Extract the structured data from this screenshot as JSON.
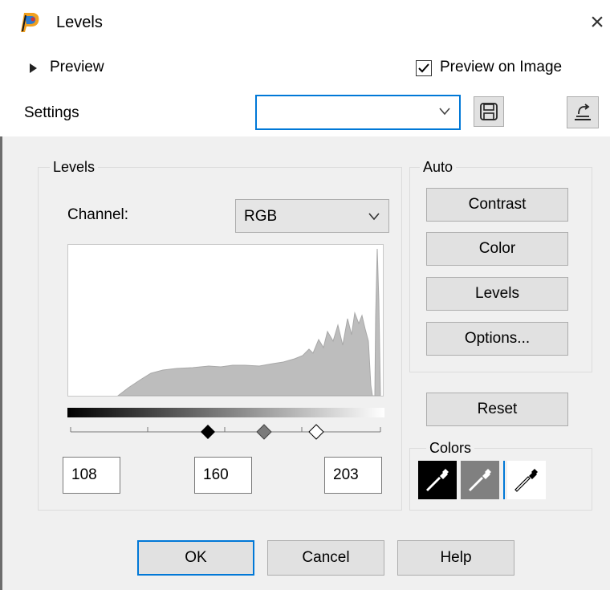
{
  "window": {
    "title": "Levels",
    "close_glyph": "×"
  },
  "top": {
    "preview_toggle": "Preview",
    "preview_on_image": {
      "label": "Preview on Image",
      "checked": true
    },
    "settings_label": "Settings",
    "settings_value": ""
  },
  "levels_group": {
    "label": "Levels",
    "channel_label": "Channel:",
    "channel_value": "RGB",
    "inputs": {
      "black": "108",
      "gray": "160",
      "white": "203"
    }
  },
  "auto_group": {
    "label": "Auto",
    "buttons": [
      "Contrast",
      "Color",
      "Levels",
      "Options..."
    ]
  },
  "reset_label": "Reset",
  "colors_group": {
    "label": "Colors"
  },
  "footer": {
    "ok": "OK",
    "cancel": "Cancel",
    "help": "Help"
  },
  "icons": [
    "app-logo-icon",
    "close-icon",
    "triangle-right-icon",
    "save-icon",
    "load-preset-icon",
    "chevron-down-icon",
    "eyedropper-icon"
  ]
}
